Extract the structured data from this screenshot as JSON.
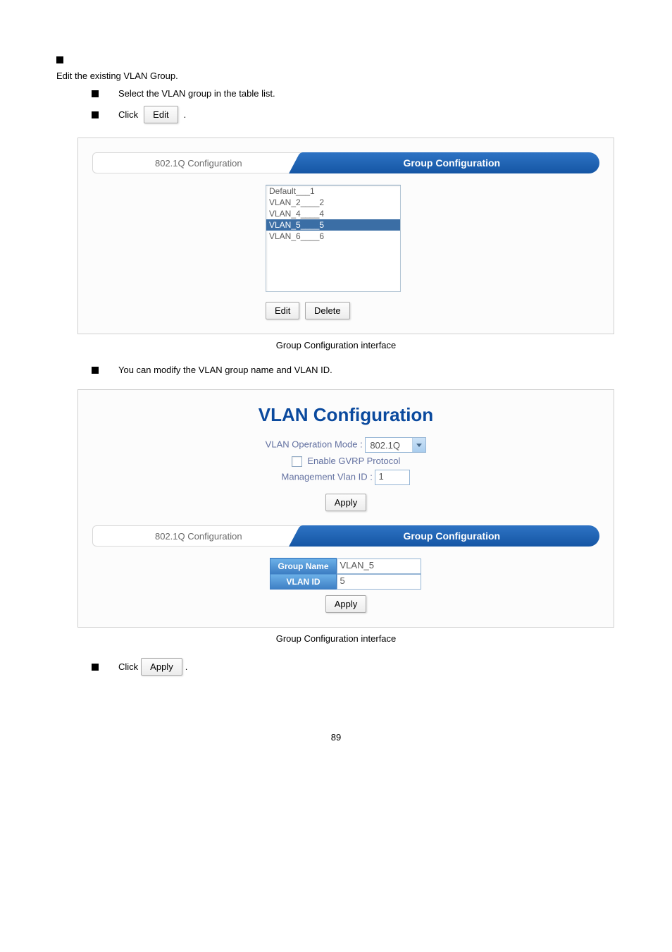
{
  "section": {
    "intro": "Edit the existing VLAN Group.",
    "step1": "Select the VLAN group in the table list.",
    "step2_prefix": "Click ",
    "step2_btn": "Edit",
    "step2_suffix": ".",
    "step3": "You can modify the VLAN group name and VLAN ID.",
    "step4_prefix": "Click ",
    "step4_btn": "Apply",
    "step4_suffix": "."
  },
  "panel1": {
    "tab_inactive": "802.1Q Configuration",
    "tab_active": "Group Configuration",
    "list": [
      {
        "label": "Default___1",
        "selected": false
      },
      {
        "label": "VLAN_2____2",
        "selected": false
      },
      {
        "label": "VLAN_4____4",
        "selected": false
      },
      {
        "label": "VLAN_5____5",
        "selected": true
      },
      {
        "label": "VLAN_6____6",
        "selected": false
      }
    ],
    "btn_edit": "Edit",
    "btn_delete": "Delete",
    "caption": "Group Configuration interface"
  },
  "panel2": {
    "title": "VLAN Configuration",
    "mode_label": "VLAN Operation Mode : ",
    "mode_value": "802.1Q",
    "gvrp_label": "Enable GVRP Protocol",
    "mgmt_label": "Management Vlan ID : ",
    "mgmt_value": "1",
    "btn_apply_top": "Apply",
    "tab_inactive": "802.1Q Configuration",
    "tab_active": "Group Configuration",
    "group_name_label": "Group Name",
    "group_name_value": "VLAN_5",
    "vlan_id_label": "VLAN ID",
    "vlan_id_value": "5",
    "btn_apply_bottom": "Apply",
    "caption": "Group Configuration interface"
  },
  "page_number": "89"
}
